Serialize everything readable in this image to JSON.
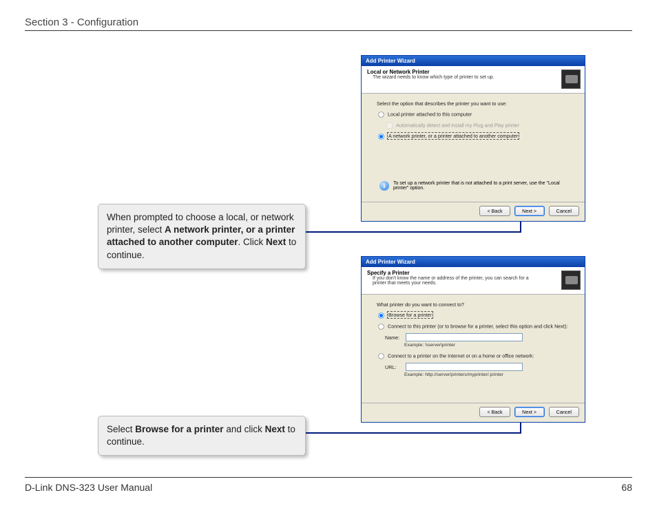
{
  "header": {
    "section": "Section 3 - Configuration"
  },
  "footer": {
    "manual": "D-Link DNS-323 User Manual",
    "page": "68"
  },
  "callouts": {
    "c1_part1": "When prompted to choose a local, or network printer, select ",
    "c1_bold1": "A network printer, or a printer attached to another computer",
    "c1_part2": ".  Click ",
    "c1_bold2": "Next",
    "c1_part3": " to continue.",
    "c2_part1": "Select ",
    "c2_bold1": "Browse for a printer",
    "c2_part2": " and click ",
    "c2_bold2": "Next",
    "c2_part3": " to continue."
  },
  "dialog1": {
    "title": "Add Printer Wizard",
    "banner_title": "Local or Network Printer",
    "banner_sub": "The wizard needs to know which type of printer to set up.",
    "prompt": "Select the option that describes the printer you want to use:",
    "opt_local": "Local printer attached to this computer",
    "chk_auto": "Automatically detect and install my Plug and Play printer",
    "opt_network": "A network printer, or a printer attached to another computer",
    "info": "To set up a network printer that is not attached to a print server, use the \"Local printer\" option.",
    "btn_back": "< Back",
    "btn_next": "Next >",
    "btn_cancel": "Cancel"
  },
  "dialog2": {
    "title": "Add Printer Wizard",
    "banner_title": "Specify a Printer",
    "banner_sub": "If you don't know the name or address of the printer, you can search for a printer that meets your needs.",
    "prompt": "What printer do you want to connect to?",
    "opt_browse": "Browse for a printer",
    "opt_connect_name": "Connect to this printer (or to browse for a printer, select this option and click Next):",
    "name_label": "Name:",
    "name_example": "Example: \\\\server\\printer",
    "opt_connect_url": "Connect to a printer on the Internet or on a home or office network:",
    "url_label": "URL:",
    "url_example": "Example: http://server/printers/myprinter/.printer",
    "btn_back": "< Back",
    "btn_next": "Next >",
    "btn_cancel": "Cancel"
  }
}
